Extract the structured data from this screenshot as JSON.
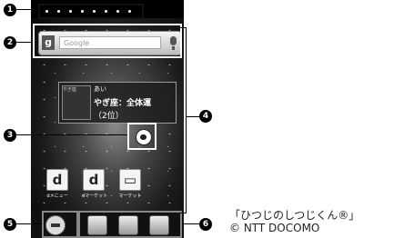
{
  "status_bar": {
    "page_dots": 8
  },
  "search": {
    "logo": "g",
    "placeholder": "Google"
  },
  "widget": {
    "title": "あい",
    "line1": "やぎ座：全体運",
    "line2": "（2位）",
    "thumbnail_label": "やぎ座"
  },
  "apps": [
    {
      "icon": "d",
      "label": "dメニュー"
    },
    {
      "icon": "d",
      "label": "dマーケット"
    },
    {
      "icon": "▭",
      "label": "マーケット"
    }
  ],
  "dock": {
    "items": [
      "phone-icon",
      "mail-icon",
      "browser-icon"
    ]
  },
  "callouts": [
    "1",
    "2",
    "3",
    "4",
    "5",
    "6"
  ],
  "caption": {
    "line1": "「ひつじのしつじくん®」",
    "line2": "© NTT DOCOMO"
  }
}
